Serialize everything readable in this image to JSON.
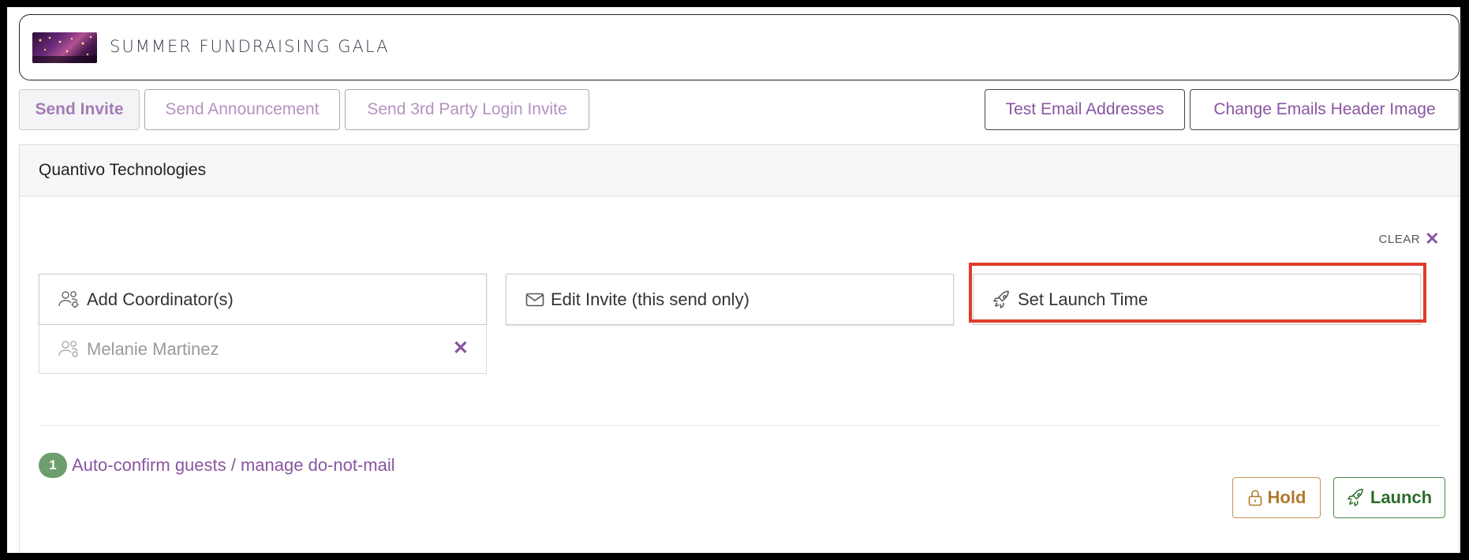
{
  "event": {
    "title": "SUMMER FUNDRAISING GALA"
  },
  "toolbar": {
    "send_invite": "Send Invite",
    "send_announcement": "Send Announcement",
    "send_3rd_party": "Send 3rd Party Login Invite",
    "test_emails": "Test Email Addresses",
    "change_header": "Change Emails Header Image"
  },
  "panel": {
    "company": "Quantivo Technologies",
    "clear_label": "CLEAR",
    "add_coordinators": "Add Coordinator(s)",
    "edit_invite": "Edit Invite (this send only)",
    "set_launch_time": "Set Launch Time",
    "coordinators": [
      {
        "name": "Melanie Martinez"
      }
    ],
    "auto_confirm_count": "1",
    "auto_confirm_label": "Auto-confirm guests / manage do-not-mail",
    "hold_label": "Hold",
    "launch_label": "Launch"
  },
  "colors": {
    "accent": "#8a55a0",
    "highlight": "#e03c2a",
    "hold": "#b07a2e",
    "launch": "#2b6e2b",
    "badge": "#6e9e6e"
  },
  "icons": {
    "coordinators": "users-gear-icon",
    "edit_invite": "envelope-icon",
    "launch_time": "rocket-icon",
    "hold": "lock-icon",
    "launch": "rocket-icon",
    "remove": "close-icon",
    "clear": "close-icon"
  }
}
